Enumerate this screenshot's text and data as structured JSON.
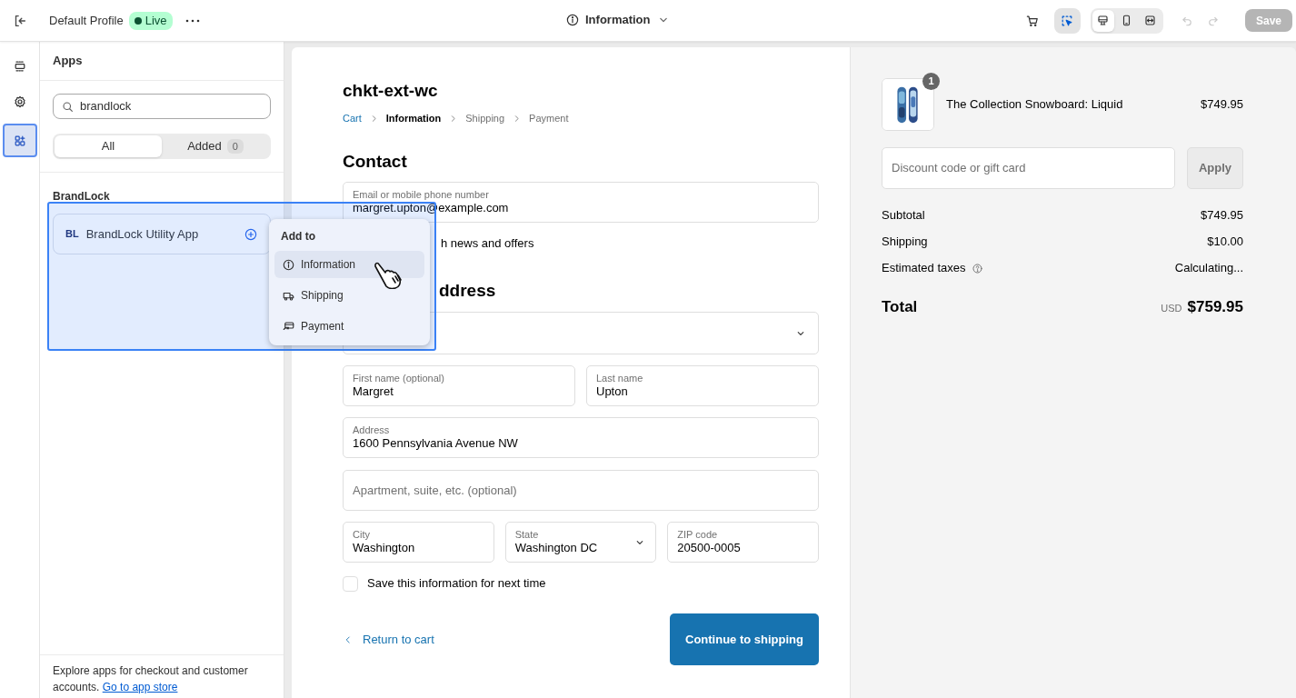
{
  "topbar": {
    "profile": "Default Profile",
    "status": {
      "label": "Live",
      "live": true
    },
    "page_selector": "Information",
    "inspector_active": true,
    "device_modes": [
      {
        "kind": "desktop",
        "selected": true
      },
      {
        "kind": "mobile",
        "selected": false
      },
      {
        "kind": "fullwidth",
        "selected": false
      }
    ],
    "save": {
      "label": "Save",
      "disabled": true
    }
  },
  "rail": [
    {
      "kind": "sections",
      "selected": false
    },
    {
      "kind": "settings",
      "selected": false
    },
    {
      "kind": "apps",
      "selected": true
    }
  ],
  "apps_panel": {
    "title": "Apps",
    "search": "brandlock",
    "filters": [
      {
        "label": "All",
        "selected": true
      },
      {
        "label": "Added",
        "count": "0",
        "selected": false
      }
    ],
    "group": "BrandLock",
    "apps": [
      {
        "badge": "BL",
        "name": "BrandLock Utility App",
        "highlighted": true
      }
    ],
    "footer": "Explore apps for checkout and customer accounts.",
    "footer_link": "Go to app store"
  },
  "add_to_menu": {
    "title": "Add to",
    "items": [
      {
        "kind": "information",
        "label": "Information",
        "selected": true
      },
      {
        "kind": "shipping",
        "label": "Shipping",
        "selected": false
      },
      {
        "kind": "payment",
        "label": "Payment",
        "selected": false
      }
    ]
  },
  "checkout": {
    "shop_name": "chkt-ext-wc",
    "breadcrumbs": [
      {
        "label": "Cart",
        "kind": "link"
      },
      {
        "label": "Information",
        "kind": "current"
      },
      {
        "label": "Shipping",
        "kind": "upcoming"
      },
      {
        "label": "Payment",
        "kind": "upcoming"
      }
    ],
    "contact_heading": "Contact",
    "email": {
      "label": "Email or mobile phone number",
      "value": "margret.upton@example.com"
    },
    "news_text": "h news and offers",
    "shipping_heading": "ddress",
    "name_fields": [
      {
        "label": "First name (optional)",
        "value": "Margret"
      },
      {
        "label": "Last name",
        "value": "Upton"
      }
    ],
    "address": {
      "label": "Address",
      "value": "1600 Pennsylvania Avenue NW"
    },
    "apartment": {
      "placeholder": "Apartment, suite, etc. (optional)"
    },
    "location_fields": [
      {
        "kind": "text",
        "label": "City",
        "value": "Washington"
      },
      {
        "kind": "select",
        "label": "State",
        "value": "Washington DC"
      },
      {
        "kind": "text",
        "label": "ZIP code",
        "value": "20500-0005"
      }
    ],
    "save_info": {
      "label": "Save this information for next time",
      "checked": false
    },
    "return_link": "Return to cart",
    "continue_button": "Continue to shipping"
  },
  "summary": {
    "product": {
      "name": "The Collection Snowboard: Liquid",
      "price": "$749.95",
      "quantity": "1"
    },
    "discount": {
      "placeholder": "Discount code or gift card",
      "button": "Apply"
    },
    "lines": [
      {
        "label": "Subtotal",
        "value": "$749.95",
        "info": false
      },
      {
        "label": "Shipping",
        "value": "$10.00",
        "info": false
      },
      {
        "label": "Estimated taxes",
        "value": "Calculating...",
        "info": true
      }
    ],
    "total": {
      "label": "Total",
      "currency": "USD",
      "amount": "$759.95"
    }
  }
}
